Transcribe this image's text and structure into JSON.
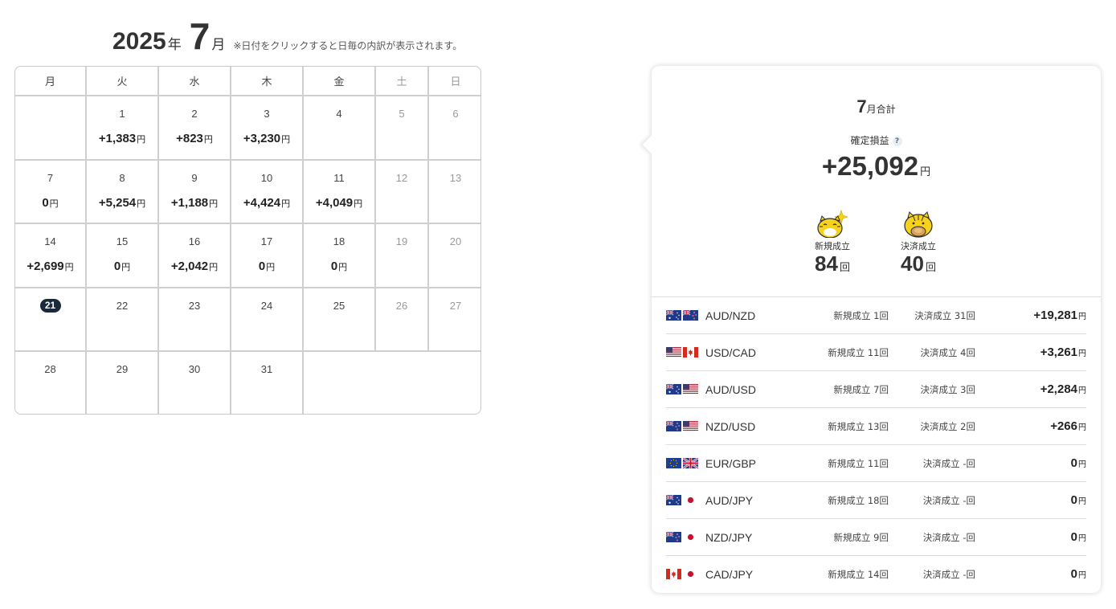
{
  "header": {
    "year": "2025",
    "year_unit": "年",
    "month": "7",
    "month_unit": "月",
    "note": "※日付をクリックすると日毎の内訳が表示されます。"
  },
  "calendar": {
    "weekdays": [
      "月",
      "火",
      "水",
      "木",
      "金",
      "土",
      "日"
    ],
    "yen": "円",
    "weeks": [
      [
        {
          "day": "",
          "pnl": ""
        },
        {
          "day": "1",
          "pnl": "+1,383"
        },
        {
          "day": "2",
          "pnl": "+823"
        },
        {
          "day": "3",
          "pnl": "+3,230"
        },
        {
          "day": "4",
          "pnl": ""
        },
        {
          "day": "5",
          "pnl": ""
        },
        {
          "day": "6",
          "pnl": ""
        }
      ],
      [
        {
          "day": "7",
          "pnl": "0"
        },
        {
          "day": "8",
          "pnl": "+5,254"
        },
        {
          "day": "9",
          "pnl": "+1,188"
        },
        {
          "day": "10",
          "pnl": "+4,424"
        },
        {
          "day": "11",
          "pnl": "+4,049"
        },
        {
          "day": "12",
          "pnl": ""
        },
        {
          "day": "13",
          "pnl": ""
        }
      ],
      [
        {
          "day": "14",
          "pnl": "+2,699"
        },
        {
          "day": "15",
          "pnl": "0"
        },
        {
          "day": "16",
          "pnl": "+2,042"
        },
        {
          "day": "17",
          "pnl": "0"
        },
        {
          "day": "18",
          "pnl": "0"
        },
        {
          "day": "19",
          "pnl": ""
        },
        {
          "day": "20",
          "pnl": ""
        }
      ],
      [
        {
          "day": "21",
          "pnl": "",
          "today": true
        },
        {
          "day": "22",
          "pnl": ""
        },
        {
          "day": "23",
          "pnl": ""
        },
        {
          "day": "24",
          "pnl": ""
        },
        {
          "day": "25",
          "pnl": ""
        },
        {
          "day": "26",
          "pnl": ""
        },
        {
          "day": "27",
          "pnl": ""
        }
      ],
      [
        {
          "day": "28",
          "pnl": ""
        },
        {
          "day": "29",
          "pnl": ""
        },
        {
          "day": "30",
          "pnl": ""
        },
        {
          "day": "31",
          "pnl": ""
        },
        {
          "day": "",
          "pnl": ""
        },
        {
          "day": "",
          "pnl": ""
        },
        {
          "day": "",
          "pnl": ""
        }
      ]
    ]
  },
  "summary": {
    "month": "7",
    "title_suffix": "月合計",
    "profit_label": "確定損益",
    "help_mark": "?",
    "total": "+25,092",
    "yen": "円",
    "new_label": "新規成立",
    "new_count": "84",
    "settle_label": "決済成立",
    "settle_count": "40",
    "count_unit": "回",
    "new_mascot": "tiger-sparkle-icon",
    "settle_mascot": "tiger-coin-icon"
  },
  "colors": {
    "text": "#333333",
    "today_badge": "#1b2a3a",
    "mascot_yellow": "#f7d21c",
    "grid_line": "#cfcfcf"
  },
  "pairs": [
    {
      "name": "AUD/NZD",
      "flag_a": "au-flag-icon",
      "flag_b": "nz-flag-icon",
      "new": "新規成立 1回",
      "settle": "決済成立 31回",
      "pnl": "+19,281"
    },
    {
      "name": "USD/CAD",
      "flag_a": "us-flag-icon",
      "flag_b": "ca-flag-icon",
      "new": "新規成立 11回",
      "settle": "決済成立 4回",
      "pnl": "+3,261"
    },
    {
      "name": "AUD/USD",
      "flag_a": "au-flag-icon",
      "flag_b": "us-flag-icon",
      "new": "新規成立 7回",
      "settle": "決済成立 3回",
      "pnl": "+2,284"
    },
    {
      "name": "NZD/USD",
      "flag_a": "nz-flag-icon",
      "flag_b": "us-flag-icon",
      "new": "新規成立 13回",
      "settle": "決済成立 2回",
      "pnl": "+266"
    },
    {
      "name": "EUR/GBP",
      "flag_a": "eu-flag-icon",
      "flag_b": "gb-flag-icon",
      "new": "新規成立 11回",
      "settle": "決済成立 -回",
      "pnl": "0"
    },
    {
      "name": "AUD/JPY",
      "flag_a": "au-flag-icon",
      "flag_b": "jp-flag-icon",
      "new": "新規成立 18回",
      "settle": "決済成立 -回",
      "pnl": "0"
    },
    {
      "name": "NZD/JPY",
      "flag_a": "nz-flag-icon",
      "flag_b": "jp-flag-icon",
      "new": "新規成立 9回",
      "settle": "決済成立 -回",
      "pnl": "0"
    },
    {
      "name": "CAD/JPY",
      "flag_a": "ca-flag-icon",
      "flag_b": "jp-flag-icon",
      "new": "新規成立 14回",
      "settle": "決済成立 -回",
      "pnl": "0"
    }
  ]
}
